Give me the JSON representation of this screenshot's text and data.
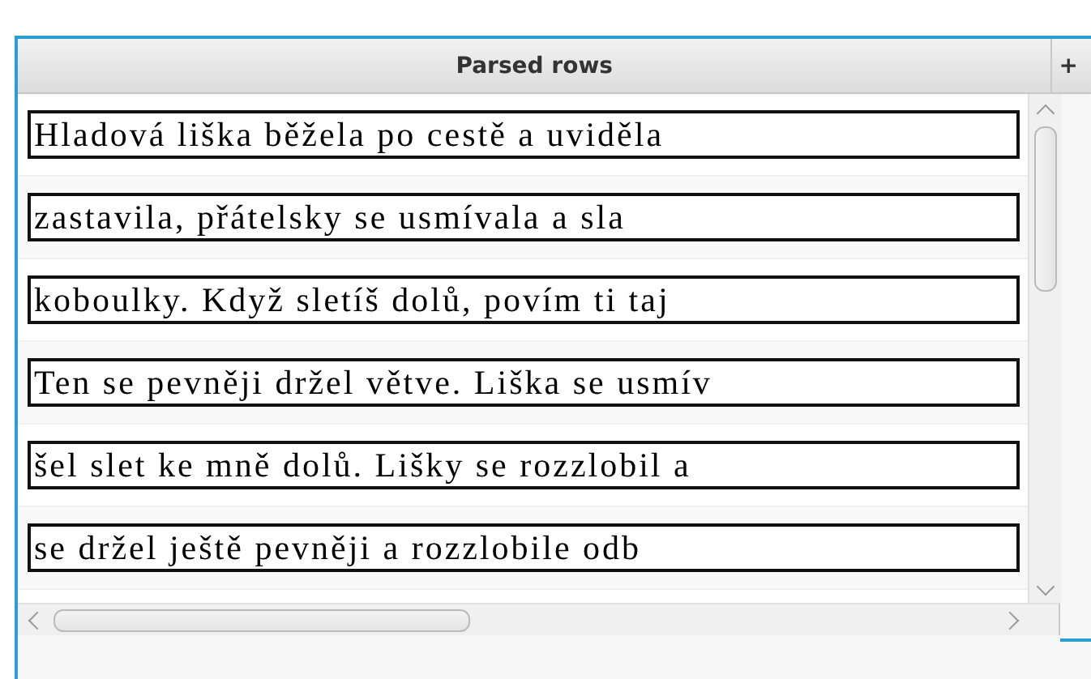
{
  "table": {
    "columns": [
      {
        "label": "Parsed rows"
      },
      {
        "label": "+"
      }
    ],
    "rows": [
      "Hladová liška běžela po cestě a uviděla",
      "zastavila, přátelsky se usmívala a sla",
      "koboulky. Když sletíš dolů, povím ti taj",
      "Ten se pevněji držel větve. Liška se usmív",
      "šel slet ke mně dolů. Lišky se rozzlobil a",
      "se držel ještě pevněji a rozzlobile odb"
    ]
  }
}
